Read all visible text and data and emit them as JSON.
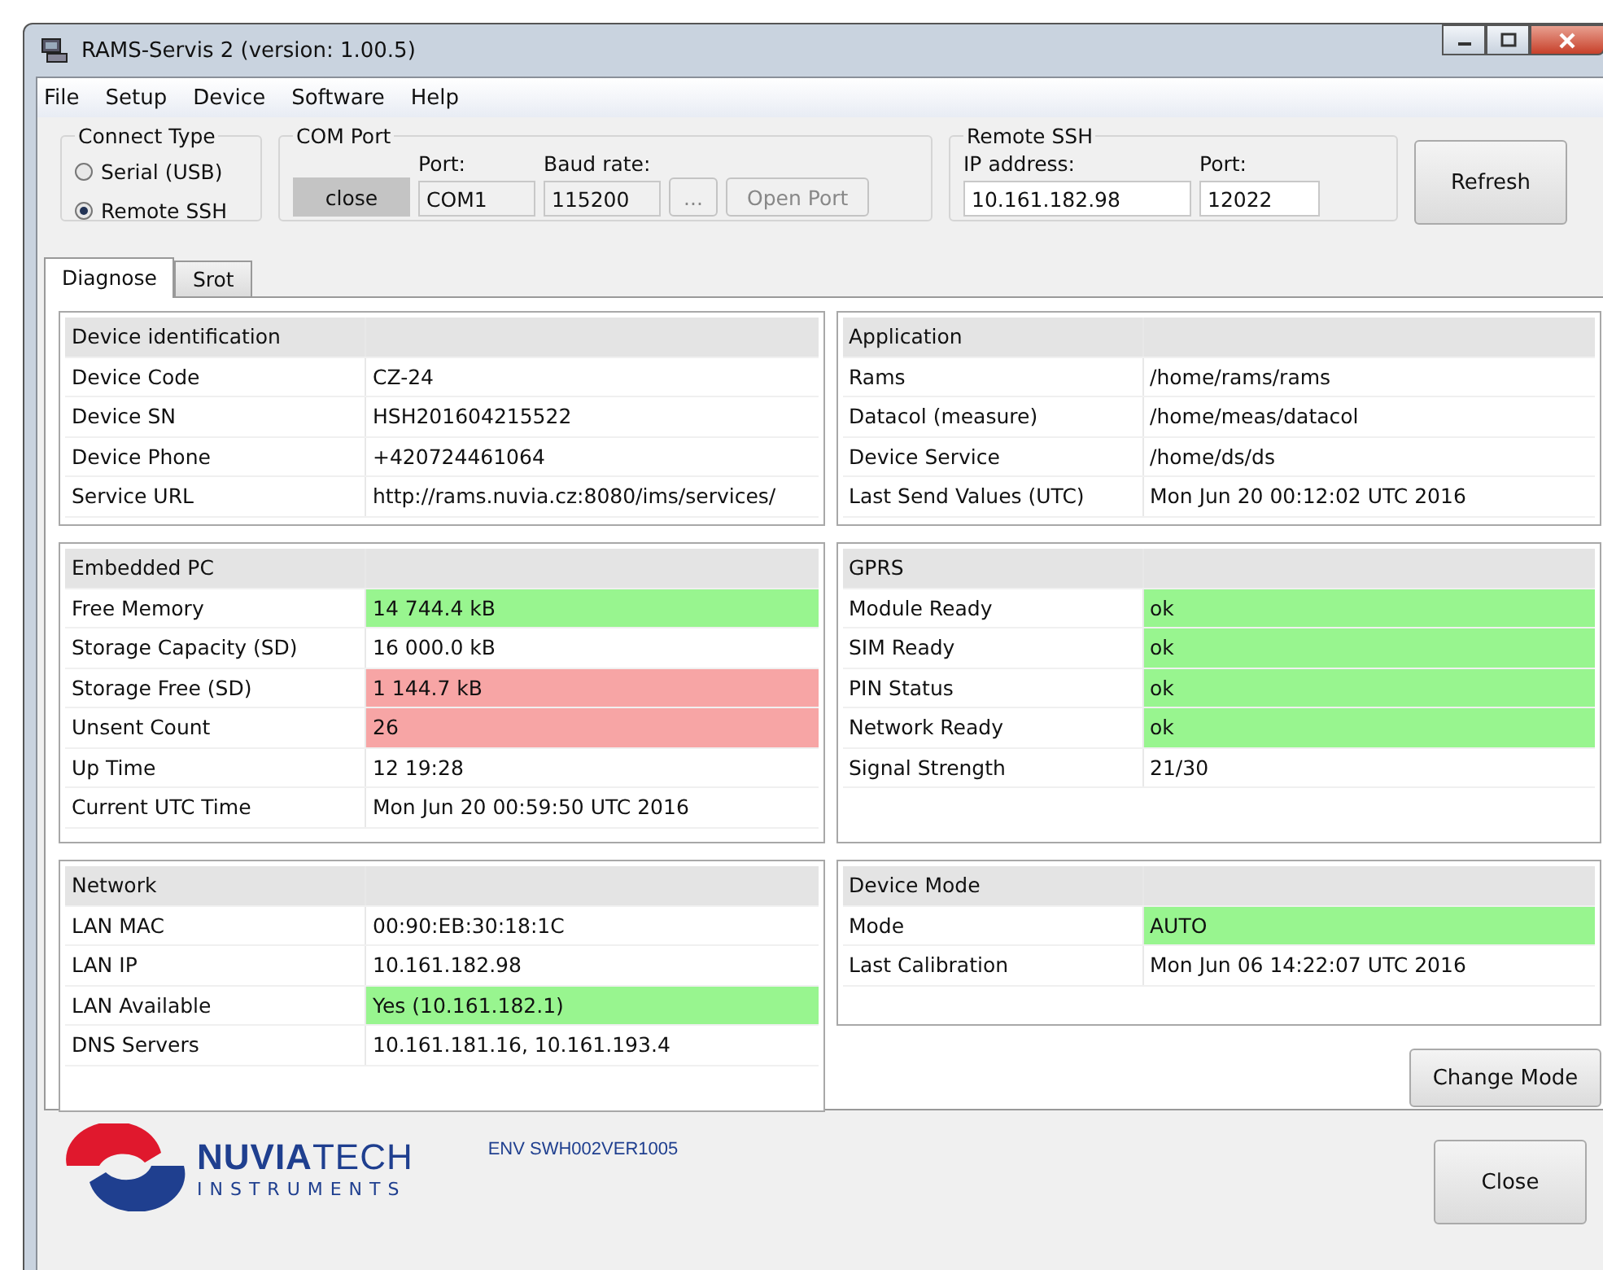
{
  "window": {
    "title": "RAMS-Servis 2  (version: 1.00.5)"
  },
  "menu": [
    "File",
    "Setup",
    "Device",
    "Software",
    "Help"
  ],
  "connect_type": {
    "title": "Connect Type",
    "options": [
      {
        "label": "Serial (USB)",
        "selected": false
      },
      {
        "label": "Remote SSH",
        "selected": true
      }
    ]
  },
  "com_port": {
    "title": "COM Port",
    "close_button": "close",
    "port_label": "Port:",
    "port": "COM1",
    "baud_label": "Baud rate:",
    "baud": "115200",
    "browse_button": "...",
    "open_button": "Open Port"
  },
  "remote_ssh": {
    "title": "Remote SSH",
    "ip_label": "IP address:",
    "ip": "10.161.182.98",
    "port_label": "Port:",
    "port": "12022"
  },
  "refresh_button": "Refresh",
  "tabs": [
    {
      "label": "Diagnose",
      "selected": true
    },
    {
      "label": "Srot",
      "selected": false
    }
  ],
  "panels": [
    {
      "title": "Device identification",
      "rows": [
        {
          "label": "Device Code",
          "value": "CZ-24"
        },
        {
          "label": "Device SN",
          "value": "HSH201604215522"
        },
        {
          "label": "Device Phone",
          "value": "+420724461064"
        },
        {
          "label": "Service URL",
          "value": "http://rams.nuvia.cz:8080/ims/services/"
        }
      ]
    },
    {
      "title": "Application",
      "rows": [
        {
          "label": "Rams",
          "value": "/home/rams/rams"
        },
        {
          "label": "Datacol (measure)",
          "value": "/home/meas/datacol"
        },
        {
          "label": "Device Service",
          "value": "/home/ds/ds"
        },
        {
          "label": "Last Send Values (UTC)",
          "value": "Mon Jun 20 00:12:02 UTC 2016"
        }
      ]
    },
    {
      "title": "Embedded PC",
      "rows": [
        {
          "label": "Free Memory",
          "value": "14 744.4 kB",
          "color": "#98f58f"
        },
        {
          "label": "Storage Capacity (SD)",
          "value": "16 000.0 kB"
        },
        {
          "label": "Storage Free (SD)",
          "value": "1 144.7 kB",
          "color": "#f7a5a5"
        },
        {
          "label": "Unsent Count",
          "value": "26",
          "color": "#f7a5a5"
        },
        {
          "label": "Up Time",
          "value": "12 19:28"
        },
        {
          "label": "Current UTC Time",
          "value": "Mon Jun 20 00:59:50 UTC 2016"
        }
      ]
    },
    {
      "title": "GPRS",
      "rows": [
        {
          "label": "Module Ready",
          "value": "ok",
          "color": "#98f58f"
        },
        {
          "label": "SIM Ready",
          "value": "ok",
          "color": "#98f58f"
        },
        {
          "label": "PIN Status",
          "value": "ok",
          "color": "#98f58f"
        },
        {
          "label": "Network Ready",
          "value": "ok",
          "color": "#98f58f"
        },
        {
          "label": "Signal Strength",
          "value": "21/30"
        }
      ]
    },
    {
      "title": "Network",
      "rows": [
        {
          "label": "LAN MAC",
          "value": "00:90:EB:30:18:1C"
        },
        {
          "label": "LAN IP",
          "value": "10.161.182.98"
        },
        {
          "label": "LAN Available",
          "value": "Yes (10.161.182.1)",
          "color": "#98f58f"
        },
        {
          "label": "DNS Servers",
          "value": "10.161.181.16, 10.161.193.4"
        }
      ]
    },
    {
      "title": "Device Mode",
      "rows": [
        {
          "label": "Mode",
          "value": "AUTO",
          "color": "#98f58f"
        },
        {
          "label": "Last Calibration",
          "value": "Mon Jun 06 14:22:07 UTC 2016"
        }
      ]
    }
  ],
  "change_mode_button": "Change Mode",
  "footer": {
    "logo_name": "**NUVIA**TECH",
    "logo_sub": "INSTRUMENTS",
    "version": "ENV SWH002VER1005",
    "close_button": "Close"
  }
}
